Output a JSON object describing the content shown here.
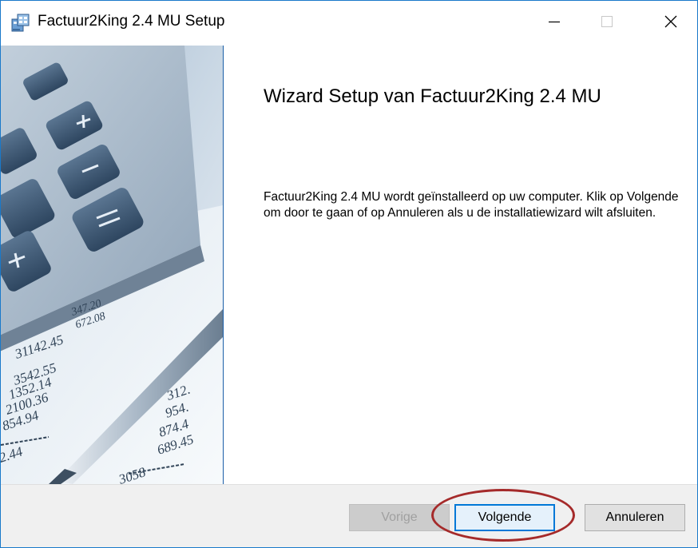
{
  "window": {
    "title": "Factuur2King 2.4 MU Setup"
  },
  "icons": {
    "app": "installer-icon",
    "minimize": "minimize-icon",
    "maximize": "maximize-icon",
    "close": "close-icon"
  },
  "side_image": {
    "numbers": [
      "31142.45",
      "3542.55",
      "1352.14",
      "2100.36",
      "854.94",
      "312.",
      "954.",
      "874.4",
      "689.45",
      "2.44",
      "3058",
      "347.20",
      "672.08"
    ]
  },
  "content": {
    "heading": "Wizard Setup van Factuur2King 2.4 MU",
    "description": "Factuur2King 2.4 MU wordt geïnstalleerd op uw computer. Klik op Volgende om door te gaan of op Annuleren als u de installatiewizard wilt afsluiten."
  },
  "buttons": {
    "back": "Vorige",
    "next": "Volgende",
    "cancel": "Annuleren"
  },
  "colors": {
    "window_border": "#1979ca",
    "default_button_border": "#0078d7",
    "annotation_circle": "#a52a2a"
  }
}
